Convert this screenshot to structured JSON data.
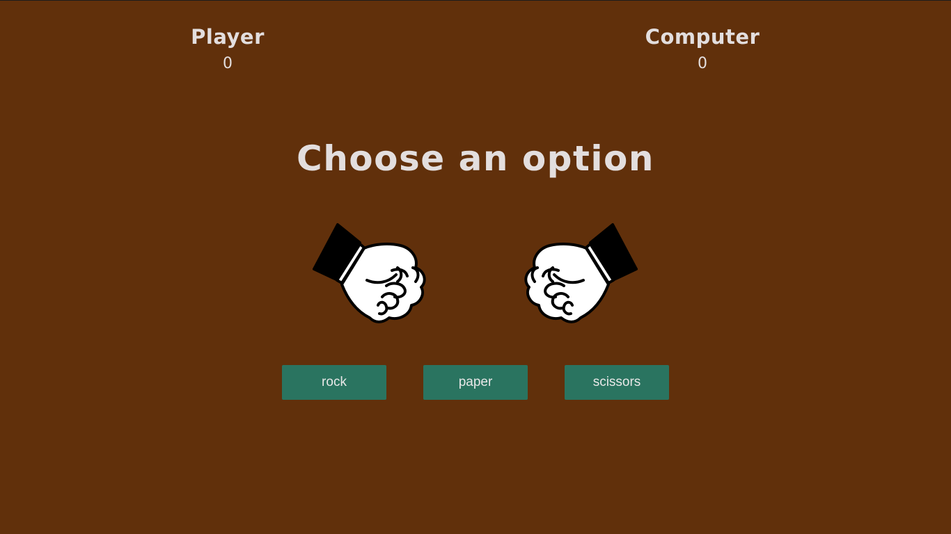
{
  "scoreboard": {
    "player": {
      "label": "Player",
      "score": "0"
    },
    "computer": {
      "label": "Computer",
      "score": "0"
    }
  },
  "prompt": "Choose an option",
  "hands": {
    "player": "fist-icon",
    "computer": "fist-icon"
  },
  "choices": [
    {
      "label": "rock"
    },
    {
      "label": "paper"
    },
    {
      "label": "scissors"
    }
  ],
  "colors": {
    "background": "#61300b",
    "text": "#e3dede",
    "button": "#2a7460",
    "button_text": "#e8e8e8"
  }
}
